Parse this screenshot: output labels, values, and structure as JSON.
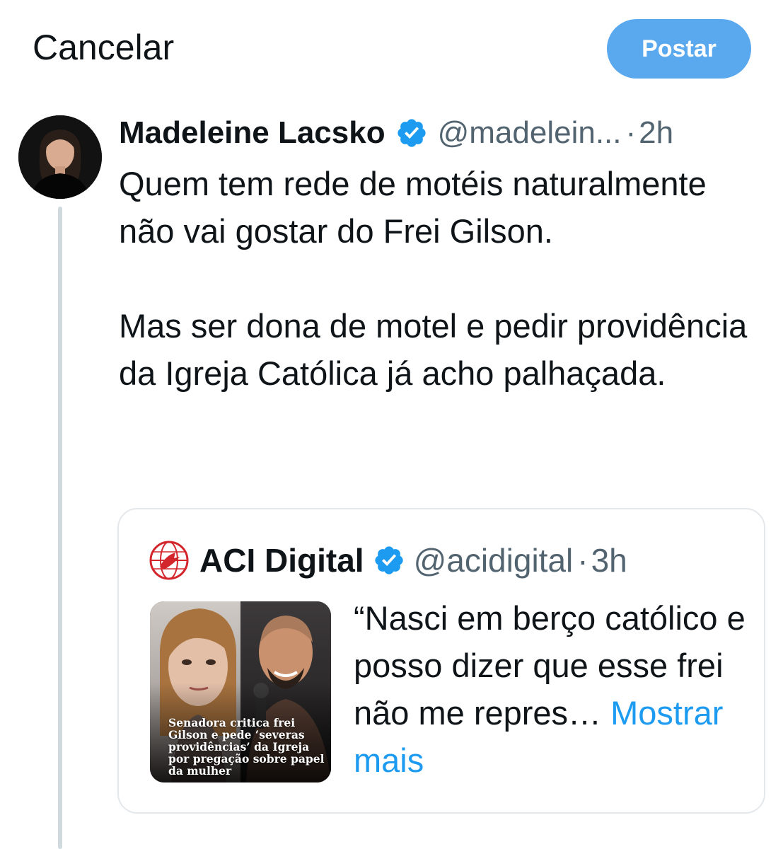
{
  "header": {
    "cancel_label": "Cancelar",
    "post_label": "Postar"
  },
  "tweet": {
    "name": "Madeleine Lacsko",
    "handle": "@madelein...",
    "separator": "·",
    "time": "2h",
    "text": "Quem tem rede de motéis naturalmente não vai gostar do Frei Gilson.\n\nMas ser dona de motel e pedir providência da Igreja Católica já acho palhaçada."
  },
  "quote": {
    "name": "ACI Digital",
    "handle": "@acidigital",
    "separator": "·",
    "time": "3h",
    "text": "“Nasci em berço católico e posso dizer que esse frei não me repres…",
    "show_more": "Mostrar mais",
    "thumbnail_caption": "Senadora critica frei Gilson e pede ‘severas providências’ da Igreja por pregação sobre papel da mulher"
  },
  "icons": {
    "verified": "verified-badge-icon",
    "aci_logo": "aci-digital-logo-icon"
  },
  "colors": {
    "post_button": "#5aa9ee",
    "link": "#1d9bf0",
    "verified": "#1d9bf0",
    "muted": "#536471",
    "thread_line": "#cfd9de"
  }
}
